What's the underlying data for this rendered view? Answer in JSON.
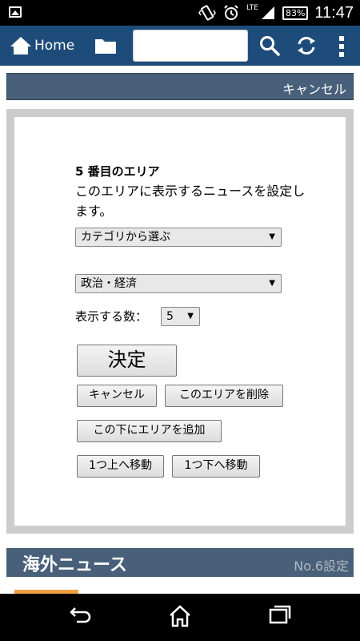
{
  "status": {
    "network": "LTE",
    "battery": "83%",
    "time": "11:47"
  },
  "toolbar": {
    "home_label": "Home",
    "search_placeholder": ""
  },
  "cancel_bar": {
    "label": "キャンセル"
  },
  "area": {
    "title": "5 番目のエリア",
    "description": "このエリアに表示するニュースを設定します。",
    "source_select": "カテゴリから選ぶ",
    "category_select": "政治・経済",
    "count_label": "表示する数：",
    "count_value": "5"
  },
  "buttons": {
    "decide": "決定",
    "cancel": "キャンセル",
    "delete_area": "このエリアを削除",
    "add_below": "この下にエリアを追加",
    "move_up": "1つ上へ移動",
    "move_down": "1つ下へ移動"
  },
  "news_section": {
    "title": "海外ニュース",
    "setting_link": "No.6設定"
  },
  "colors": {
    "toolbar": "#1e4c7a",
    "section_header": "#48607a",
    "panel_border": "#cccccc"
  }
}
